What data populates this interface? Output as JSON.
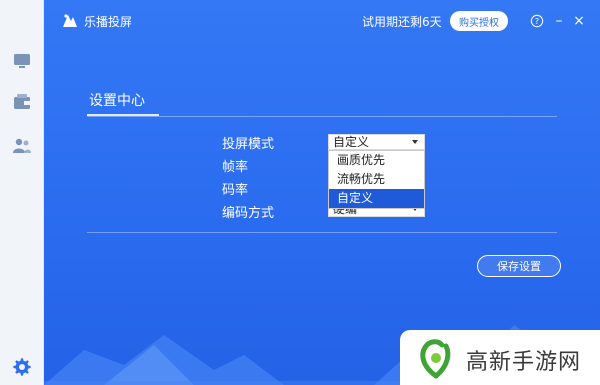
{
  "app": {
    "title": "乐播投屏"
  },
  "titlebar": {
    "trial_text": "试用期还剩6天",
    "buy_label": "购买授权",
    "help_symbol": "?",
    "minimize_symbol": "–",
    "close_symbol": "×"
  },
  "sidebar": {
    "icons": [
      "monitor-icon",
      "wallet-icon",
      "users-icon",
      "settings-gear-icon"
    ]
  },
  "settings": {
    "title": "设置中心",
    "fields": [
      {
        "label": "投屏模式",
        "value": "自定义"
      },
      {
        "label": "帧率",
        "value": ""
      },
      {
        "label": "码率",
        "value": ""
      },
      {
        "label": "编码方式",
        "value": "硬编"
      }
    ],
    "dropdown_options": [
      "画质优先",
      "流畅优先",
      "自定义"
    ],
    "dropdown_selected": "自定义",
    "save_label": "保存设置"
  },
  "watermark": {
    "text": "高新手游网"
  },
  "colors": {
    "accent": "#2d6ff0",
    "selected": "#1f5bd9",
    "sidebar_bg": "#f1f4f9"
  }
}
